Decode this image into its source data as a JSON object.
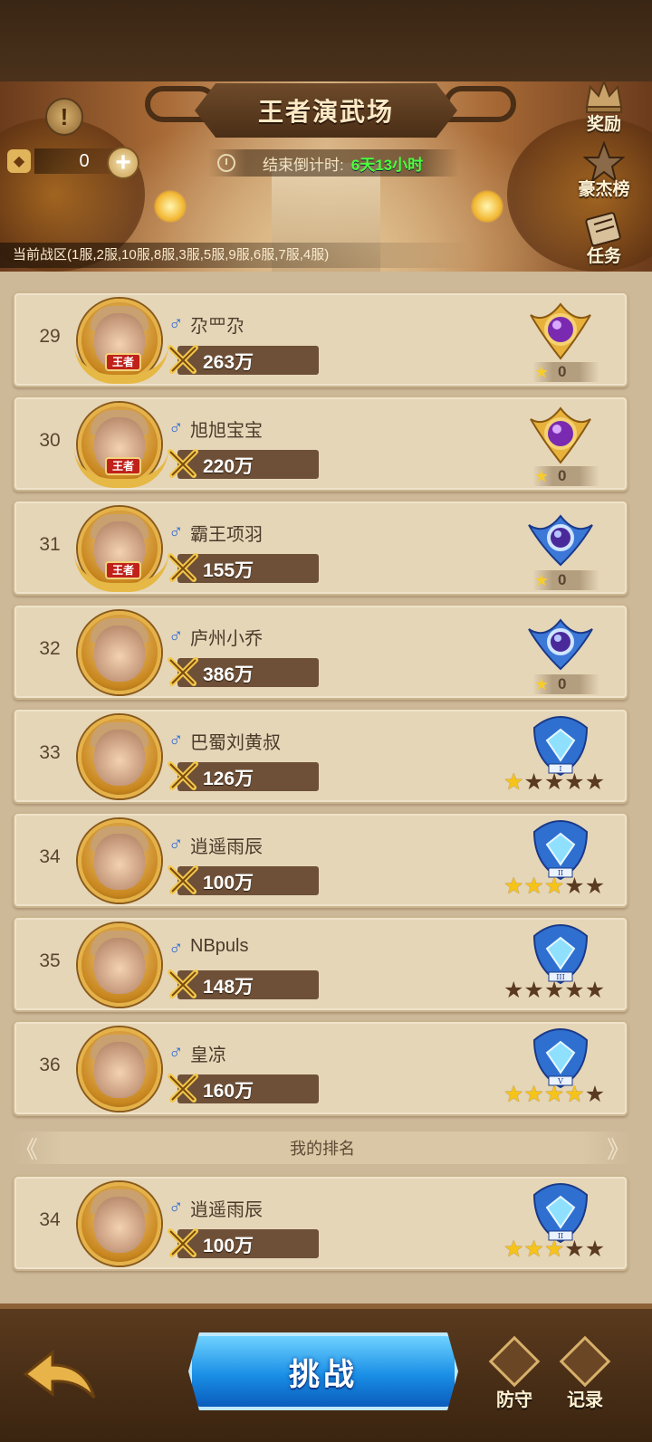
{
  "header": {
    "title": "王者演武场",
    "resource_value": "0",
    "countdown_label": "结束倒计时:",
    "countdown_value": "6天13小时",
    "zone_text": "当前战区(1服,2服,10服,8服,3服,5服,9服,6服,7服,4服)"
  },
  "side_buttons": {
    "rewards": "奖励",
    "heroes_ranking": "豪杰榜",
    "tasks": "任务"
  },
  "rankings": [
    {
      "rank": "29",
      "gender": "♂",
      "name": "尕罒尕",
      "power": "263万",
      "tier": "king",
      "stars": "0",
      "badge": "王者"
    },
    {
      "rank": "30",
      "gender": "♂",
      "name": "旭旭宝宝",
      "power": "220万",
      "tier": "king",
      "stars": "0",
      "badge": "王者"
    },
    {
      "rank": "31",
      "gender": "♂",
      "name": "霸王项羽",
      "power": "155万",
      "tier": "star",
      "stars": "0",
      "badge": "王者"
    },
    {
      "rank": "32",
      "gender": "♂",
      "name": "庐州小乔",
      "power": "386万",
      "tier": "star",
      "stars": "0",
      "badge": ""
    },
    {
      "rank": "33",
      "gender": "♂",
      "name": "巴蜀刘黄叔",
      "power": "126万",
      "tier": "diamond",
      "level": "I",
      "stars_filled": 1
    },
    {
      "rank": "34",
      "gender": "♂",
      "name": "逍遥雨辰",
      "power": "100万",
      "tier": "diamond",
      "level": "II",
      "stars_filled": 3
    },
    {
      "rank": "35",
      "gender": "♂",
      "name": "NBpuls",
      "power": "148万",
      "tier": "diamond",
      "level": "III",
      "stars_filled": 0
    },
    {
      "rank": "36",
      "gender": "♂",
      "name": "皇凉",
      "power": "160万",
      "tier": "diamond",
      "level": "V",
      "stars_filled": 4
    }
  ],
  "my_rank": {
    "divider_label": "我的排名",
    "rank": "34",
    "gender": "♂",
    "name": "逍遥雨辰",
    "power": "100万",
    "level": "II",
    "stars_filled": 3
  },
  "bottom": {
    "challenge_label": "挑战",
    "defend_label": "防守",
    "records_label": "记录"
  },
  "colors": {
    "green_countdown": "#4cff3c",
    "gender_blue": "#2a6ad6",
    "challenge_blue": "#1a8fe6"
  }
}
